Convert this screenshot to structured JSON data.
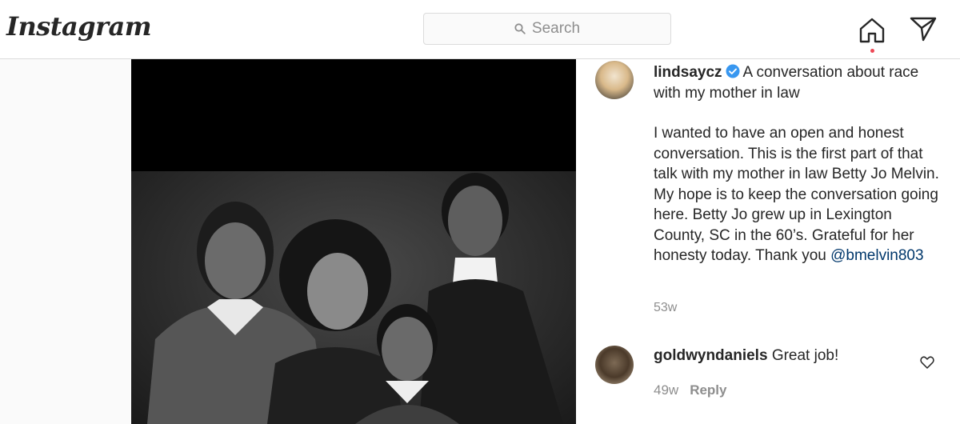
{
  "header": {
    "logo_text": "Instagram",
    "search_placeholder": "Search",
    "icons": [
      "search-icon",
      "home-icon",
      "direct-message-icon"
    ]
  },
  "post": {
    "author": {
      "username": "lindsaycz",
      "verified": true
    },
    "caption_title": "A conversation about race with my mother in law",
    "caption_body": "I wanted to have an open and honest conversation. This is the first part of that talk with my mother in law Betty Jo Melvin. My hope is to keep the conversation going here. Betty Jo grew up in Lexington County, SC in the 60’s. Grateful for her honesty today. Thank you",
    "mention": "@bmelvin803",
    "time": "53w"
  },
  "comments": [
    {
      "username": "goldwyndaniels",
      "text": "Great job!",
      "time": "49w",
      "reply_label": "Reply"
    }
  ],
  "colors": {
    "verified": "#3897f0",
    "mention": "#00376b",
    "notification_dot": "#ed4956",
    "muted_text": "#8e8e8e"
  }
}
